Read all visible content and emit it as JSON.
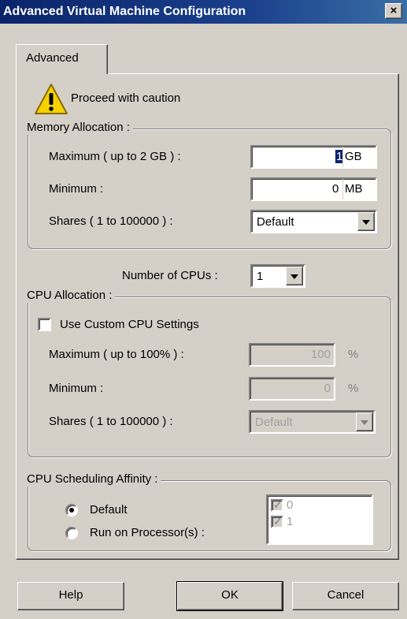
{
  "window": {
    "title": "Advanced Virtual Machine Configuration",
    "close": "×"
  },
  "tab": {
    "label": "Advanced"
  },
  "caution": {
    "text": "Proceed with caution",
    "icon": "warning-icon"
  },
  "memory": {
    "legend": "Memory Allocation :",
    "max_label": "Maximum ( up to 2 GB ) :",
    "max_value": "1",
    "max_unit": "GB",
    "min_label": "Minimum :",
    "min_value": "0",
    "min_unit": "MB",
    "shares_label": "Shares ( 1 to 100000 ) :",
    "shares_value": "Default"
  },
  "cpus": {
    "label": "Number of CPUs :",
    "value": "1"
  },
  "cpu_alloc": {
    "legend": "CPU Allocation :",
    "custom_label": "Use Custom CPU Settings",
    "max_label": "Maximum ( up to 100% ) :",
    "max_value": "100",
    "max_unit": "%",
    "min_label": "Minimum :",
    "min_value": "0",
    "min_unit": "%",
    "shares_label": "Shares ( 1 to 100000 ) :",
    "shares_value": "Default"
  },
  "affinity": {
    "legend": "CPU Scheduling Affinity :",
    "default_label": "Default",
    "run_label": "Run on Processor(s) :",
    "processors": [
      "0",
      "1"
    ]
  },
  "buttons": {
    "help": "Help",
    "ok": "OK",
    "cancel": "Cancel"
  },
  "colors": {
    "title_bar": "#0a246a",
    "face": "#d4d0c8",
    "warning": "#f5d200"
  }
}
